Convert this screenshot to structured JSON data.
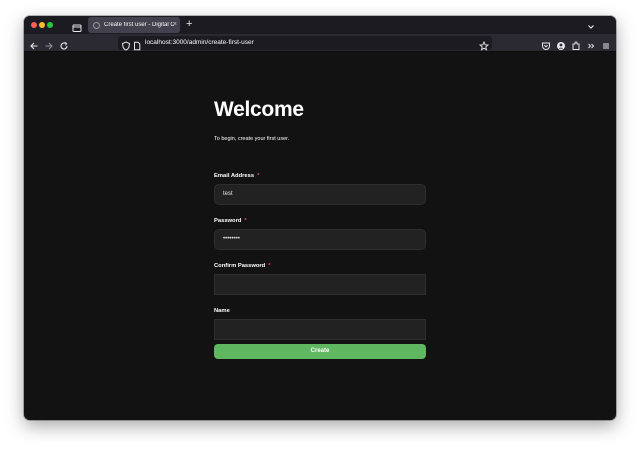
{
  "browser": {
    "tab_title": "Create first user - Digital Creat",
    "tab_close": "×",
    "new_tab": "+",
    "url": "localhost:3000/admin/create-first-user",
    "icons": [
      "back-icon",
      "forward-icon",
      "reload-icon",
      "shield-icon",
      "page-icon",
      "bookmark-star-icon",
      "pocket-icon",
      "account-icon",
      "extensions-icon",
      "overflow-icon",
      "menu-icon"
    ]
  },
  "page": {
    "heading": "Welcome",
    "subtitle": "To begin, create your first user.",
    "required_marker": "*",
    "fields": {
      "email": {
        "label": "Email Address",
        "value": "test"
      },
      "password": {
        "label": "Password",
        "value": "••••••••"
      },
      "confirm_password": {
        "label": "Confirm Password",
        "value": ""
      },
      "name": {
        "label": "Name",
        "value": ""
      }
    },
    "submit_label": "Create",
    "colors": {
      "background": "#121212",
      "input": "#222222",
      "accent": "#5fb85f",
      "required": "#e5534b"
    }
  }
}
